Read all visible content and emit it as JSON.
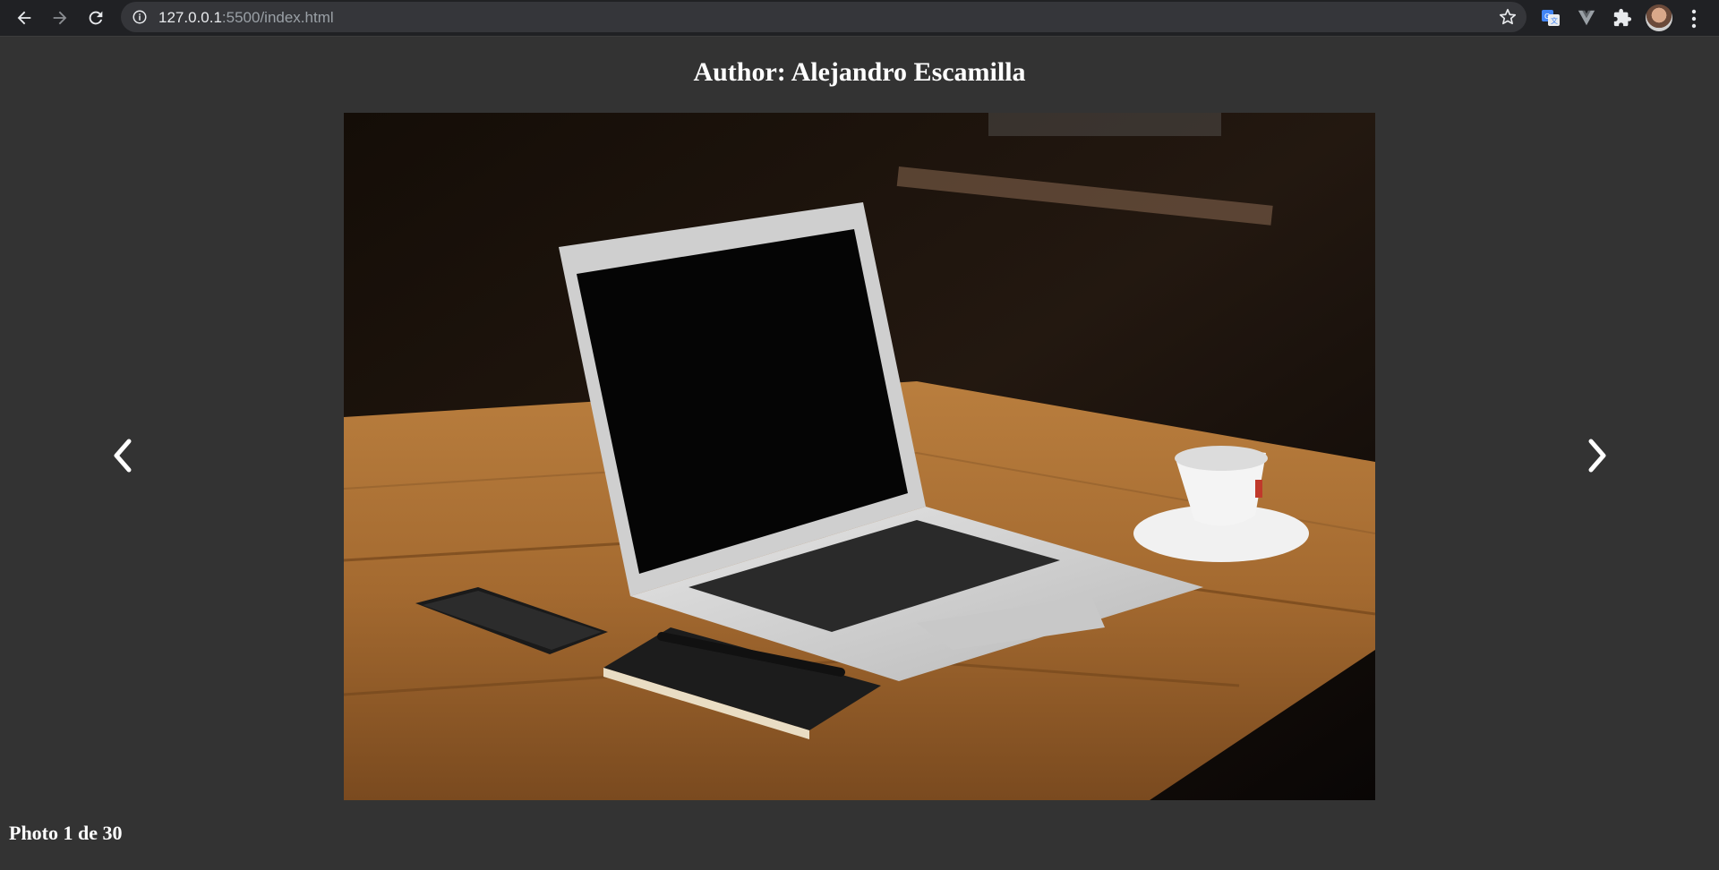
{
  "browser": {
    "url_host": "127.0.0.1",
    "url_rest": ":5500/index.html",
    "icons": [
      "back-icon",
      "forward-icon",
      "reload-icon",
      "info-icon",
      "star-icon",
      "translate-icon",
      "vue-devtools-icon",
      "extensions-icon",
      "avatar",
      "menu-icon"
    ]
  },
  "page": {
    "title": "Author: Alejandro Escamilla",
    "counter": "Photo 1 de 30",
    "prev_icon": "chevron-left-icon",
    "next_icon": "chevron-right-icon",
    "photo_subject": "laptop-on-wooden-table"
  },
  "colors": {
    "page_bg": "#333333",
    "chrome_bg": "#202124",
    "omnibox_bg": "#35363a",
    "text": "#ffffff"
  }
}
